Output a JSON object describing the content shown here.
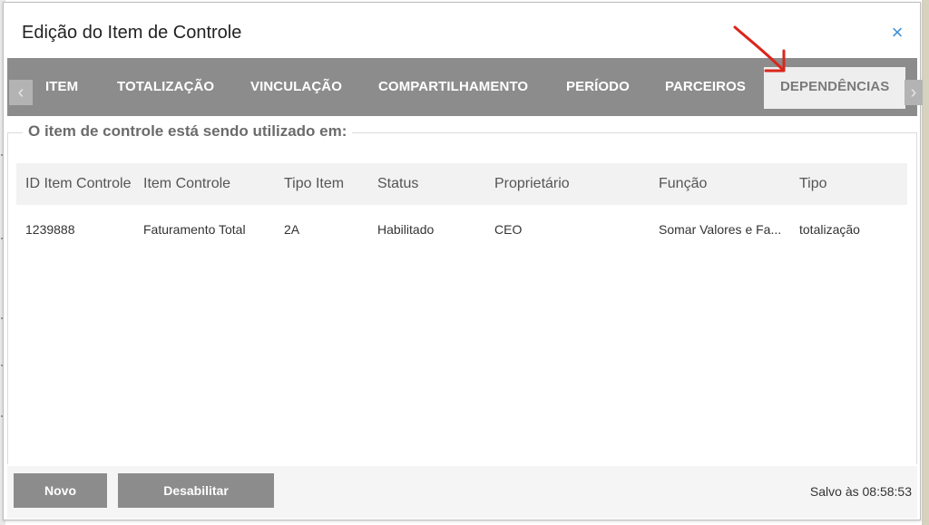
{
  "dialog": {
    "title": "Edição do Item de Controle",
    "close_icon": "×"
  },
  "tabs": [
    {
      "label": "ITEM",
      "active": false
    },
    {
      "label": "TOTALIZAÇÃO",
      "active": false
    },
    {
      "label": "VINCULAÇÃO",
      "active": false
    },
    {
      "label": "COMPARTILHAMENTO",
      "active": false
    },
    {
      "label": "PERÍODO",
      "active": false
    },
    {
      "label": "PARCEIROS",
      "active": false
    },
    {
      "label": "DEPENDÊNCIAS",
      "active": true
    }
  ],
  "tab_scroll": {
    "left_icon": "‹",
    "right_icon": "›"
  },
  "section": {
    "legend": "O item de controle está sendo utilizado em:"
  },
  "table": {
    "headers": [
      "ID Item Controle",
      "Item Controle",
      "Tipo Item",
      "Status",
      "Proprietário",
      "Função",
      "Tipo"
    ],
    "rows": [
      [
        "1239888",
        "Faturamento Total",
        "2A",
        "Habilitado",
        "CEO",
        "Somar Valores e Fa...",
        "totalização"
      ]
    ]
  },
  "footer": {
    "novo_label": "Novo",
    "desabilitar_label": "Desabilitar",
    "saved_text": "Salvo às 08:58:53"
  },
  "colors": {
    "tabbar": "#8c8c8c",
    "active_tab": "#eeeeee",
    "close_icon": "#3b8fd8",
    "annotation_arrow": "#d9261c"
  }
}
